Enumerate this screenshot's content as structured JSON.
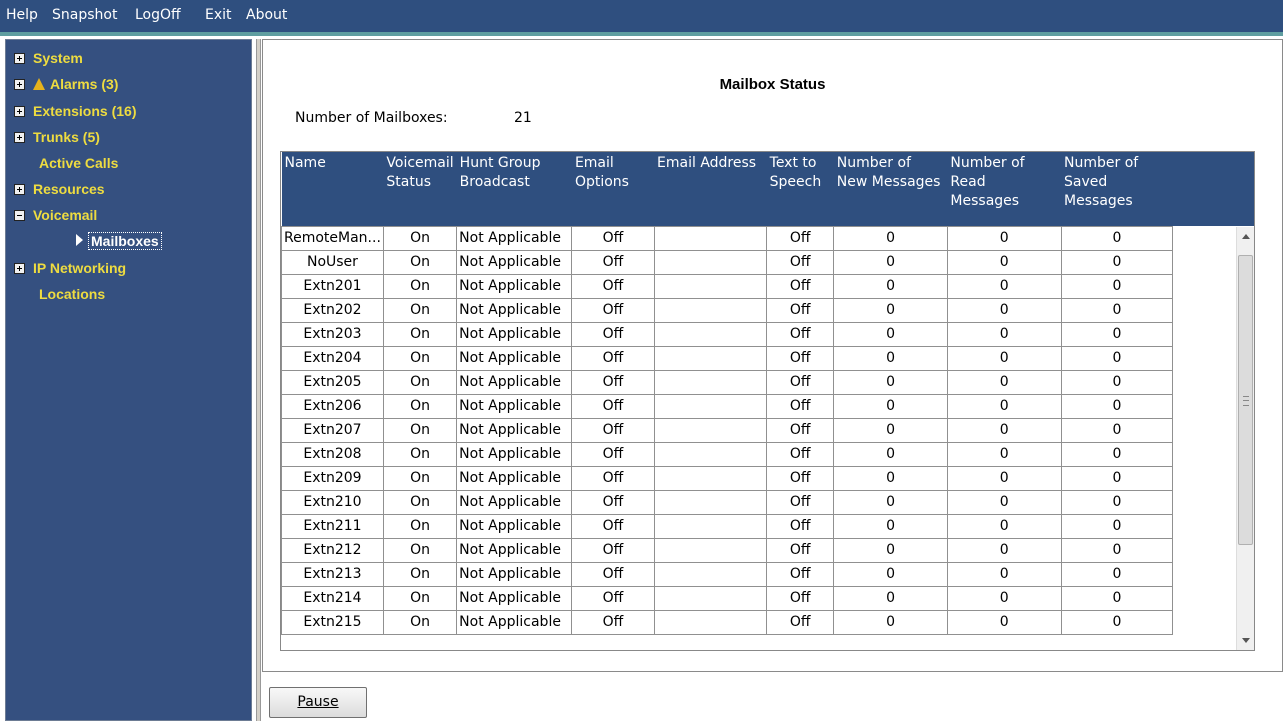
{
  "menu": [
    "Help",
    "Snapshot",
    "LogOff",
    "Exit",
    "About"
  ],
  "nav": {
    "system": "System",
    "alarms": "Alarms (3)",
    "extensions": "Extensions (16)",
    "trunks": "Trunks (5)",
    "active_calls": "Active Calls",
    "resources": "Resources",
    "voicemail": "Voicemail",
    "mailboxes": "Mailboxes",
    "ip_networking": "IP Networking",
    "locations": "Locations"
  },
  "panel": {
    "title": "Mailbox Status",
    "count_label": "Number of Mailboxes:",
    "count_value": "21"
  },
  "table": {
    "columns": [
      "Name",
      "Voicemail Status",
      "Hunt Group Broadcast",
      "Email Options",
      "Email Address",
      "Text to Speech",
      "Number of New Messages",
      "Number of Read Messages",
      "Number of Saved Messages"
    ],
    "rows": [
      [
        "RemoteMan...",
        "On",
        "Not Applicable",
        "Off",
        "",
        "Off",
        "0",
        "0",
        "0"
      ],
      [
        "NoUser",
        "On",
        "Not Applicable",
        "Off",
        "",
        "Off",
        "0",
        "0",
        "0"
      ],
      [
        "Extn201",
        "On",
        "Not Applicable",
        "Off",
        "",
        "Off",
        "0",
        "0",
        "0"
      ],
      [
        "Extn202",
        "On",
        "Not Applicable",
        "Off",
        "",
        "Off",
        "0",
        "0",
        "0"
      ],
      [
        "Extn203",
        "On",
        "Not Applicable",
        "Off",
        "",
        "Off",
        "0",
        "0",
        "0"
      ],
      [
        "Extn204",
        "On",
        "Not Applicable",
        "Off",
        "",
        "Off",
        "0",
        "0",
        "0"
      ],
      [
        "Extn205",
        "On",
        "Not Applicable",
        "Off",
        "",
        "Off",
        "0",
        "0",
        "0"
      ],
      [
        "Extn206",
        "On",
        "Not Applicable",
        "Off",
        "",
        "Off",
        "0",
        "0",
        "0"
      ],
      [
        "Extn207",
        "On",
        "Not Applicable",
        "Off",
        "",
        "Off",
        "0",
        "0",
        "0"
      ],
      [
        "Extn208",
        "On",
        "Not Applicable",
        "Off",
        "",
        "Off",
        "0",
        "0",
        "0"
      ],
      [
        "Extn209",
        "On",
        "Not Applicable",
        "Off",
        "",
        "Off",
        "0",
        "0",
        "0"
      ],
      [
        "Extn210",
        "On",
        "Not Applicable",
        "Off",
        "",
        "Off",
        "0",
        "0",
        "0"
      ],
      [
        "Extn211",
        "On",
        "Not Applicable",
        "Off",
        "",
        "Off",
        "0",
        "0",
        "0"
      ],
      [
        "Extn212",
        "On",
        "Not Applicable",
        "Off",
        "",
        "Off",
        "0",
        "0",
        "0"
      ],
      [
        "Extn213",
        "On",
        "Not Applicable",
        "Off",
        "",
        "Off",
        "0",
        "0",
        "0"
      ],
      [
        "Extn214",
        "On",
        "Not Applicable",
        "Off",
        "",
        "Off",
        "0",
        "0",
        "0"
      ],
      [
        "Extn215",
        "On",
        "Not Applicable",
        "Off",
        "",
        "Off",
        "0",
        "0",
        "0"
      ]
    ]
  },
  "pause_label": "Pause",
  "colors": {
    "menubar": "#2f4f7f",
    "nav_text": "#eedc40",
    "header": "#2f4f7f"
  }
}
